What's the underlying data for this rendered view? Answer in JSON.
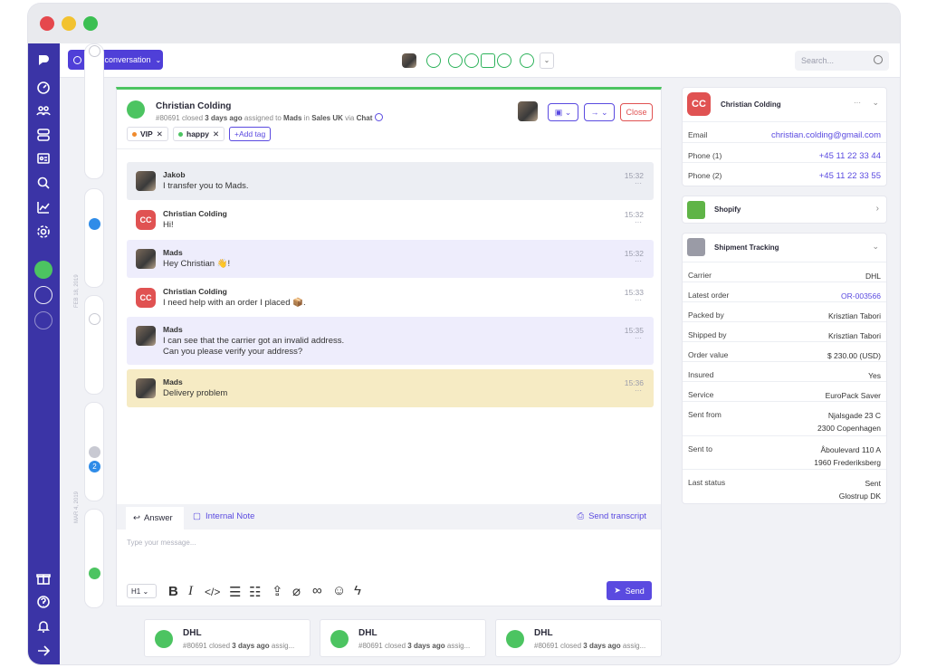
{
  "window": {
    "dots": [
      "#e5484d",
      "#f2c230",
      "#3bbf52"
    ]
  },
  "topbar": {
    "new_conversation": "New conversation",
    "search_placeholder": "Search..."
  },
  "timeline": {
    "date1": "FEB 18, 2019",
    "date2": "MAR 4, 2019",
    "badge": "2"
  },
  "conversation": {
    "name": "Christian Colding",
    "id": "#80691",
    "status_text": "closed",
    "time_ago": "3 days ago",
    "assigned_text": "assigned to",
    "assignee": "Mads",
    "in_text": "in",
    "team": "Sales UK",
    "via_text": "via",
    "channel": "Chat",
    "tags": [
      "VIP",
      "happy"
    ],
    "add_tag": "+Add tag",
    "close_label": "Close",
    "messages": [
      {
        "who": "Jakob",
        "text": "I transfer you to Mads.",
        "time": "15:32",
        "more": "···"
      },
      {
        "who": "Christian Colding",
        "text": "Hi!",
        "time": "15:32",
        "more": "···",
        "avatar": "CC"
      },
      {
        "who": "Mads",
        "text": "Hey Christian 👋!",
        "time": "15:32",
        "more": "···"
      },
      {
        "who": "Christian Colding",
        "text": "I need help with an order I placed 📦.",
        "time": "15:33",
        "more": "···",
        "avatar": "CC"
      },
      {
        "who": "Mads",
        "text": "I can see that the carrier got an invalid address.\nCan you please verify your address?",
        "time": "15:35",
        "more": "···"
      },
      {
        "who": "Mads",
        "text": "Delivery problem",
        "time": "15:36",
        "more": "···"
      }
    ],
    "tabs": {
      "answer": "Answer",
      "internal_note": "Internal Note",
      "send_transcript": "Send transcript"
    },
    "composer_placeholder": "Type your message...",
    "heading_select": "H1",
    "send_label": "Send"
  },
  "contact": {
    "avatar": "CC",
    "name": "Christian Colding",
    "more": "···",
    "rows": [
      {
        "k": "Email",
        "v": "christian.colding@gmail.com"
      },
      {
        "k": "Phone (1)",
        "v": "+45 11 22 33 44"
      },
      {
        "k": "Phone (2)",
        "v": "+45 11 22 33 55"
      }
    ]
  },
  "shopify": {
    "label": "Shopify"
  },
  "shipment": {
    "label": "Shipment Tracking",
    "rows": [
      {
        "k": "Carrier",
        "v": "DHL"
      },
      {
        "k": "Latest order",
        "v": "OR-003566"
      },
      {
        "k": "Packed by",
        "v": "Krisztian Tabori"
      },
      {
        "k": "Shipped by",
        "v": "Krisztian Tabori"
      },
      {
        "k": "Order value",
        "v": "$ 230.00 (USD)"
      },
      {
        "k": "Insured",
        "v": "Yes"
      },
      {
        "k": "Service",
        "v": "EuroPack Saver"
      },
      {
        "k": "Sent from",
        "v": "Njalsgade 23 C\n2300 Copenhagen"
      },
      {
        "k": "Sent to",
        "v": "Åboulevard 110 A\n1960 Frederiksberg"
      },
      {
        "k": "Last status",
        "v": "Sent\nGlostrup DK"
      }
    ]
  },
  "cards": [
    {
      "title": "DHL",
      "id": "#80691",
      "status": "closed",
      "ago": "3 days ago",
      "rest": "assig..."
    },
    {
      "title": "DHL",
      "id": "#80691",
      "status": "closed",
      "ago": "3 days ago",
      "rest": "assig..."
    },
    {
      "title": "DHL",
      "id": "#80691",
      "status": "closed",
      "ago": "3 days ago",
      "rest": "assig..."
    }
  ],
  "colors": {
    "brand": "#3b34a6",
    "accent": "#4f3fd8",
    "link": "#5a4ae0",
    "green": "#4cc461",
    "cc_red": "#e05252",
    "highlight": "#f6ebc4",
    "agent_bg": "#eeedfc"
  }
}
